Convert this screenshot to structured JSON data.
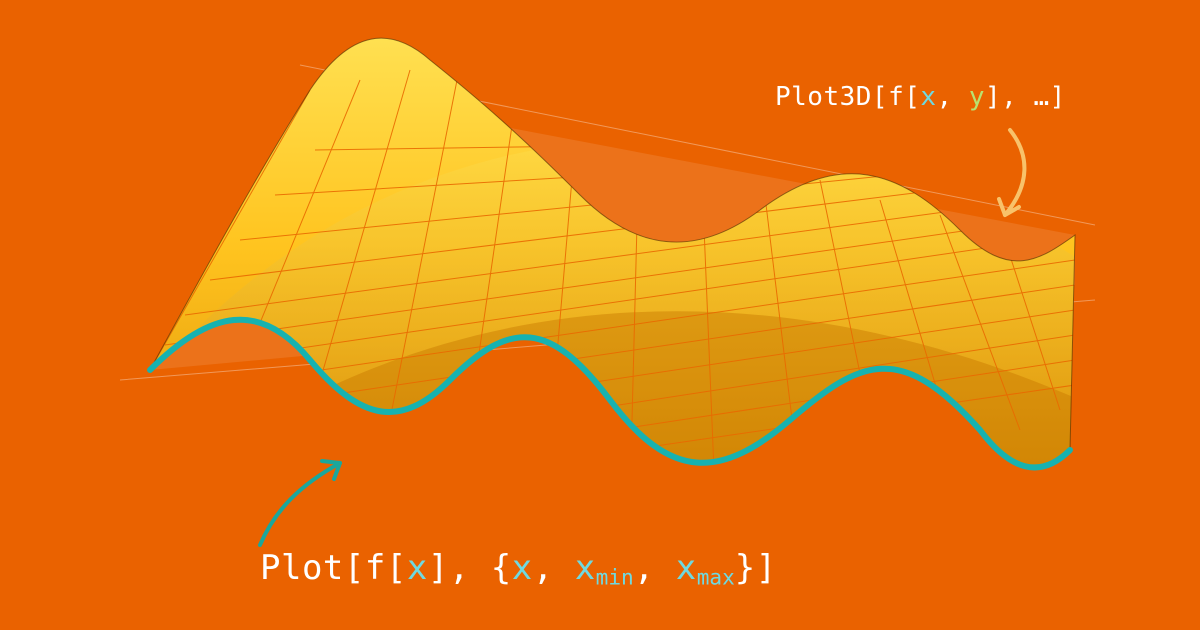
{
  "background_color": "#ea6200",
  "labels": {
    "top": {
      "fn": "Plot3D",
      "open": "[",
      "inner_fn": "f",
      "inner_open": "[",
      "arg1": "x",
      "sep1": ", ",
      "arg2": "y",
      "inner_close": "]",
      "sep2": ", ",
      "ellipsis": "…",
      "close": "]"
    },
    "bottom": {
      "fn": "Plot",
      "open": "[",
      "inner_fn": "f",
      "inner_open": "[",
      "arg1": "x",
      "inner_close": "]",
      "sep1": ", ",
      "brace_open": "{",
      "r_arg": "x",
      "sep2": ", ",
      "r_min_base": "x",
      "r_min_sub": "min",
      "sep3": ", ",
      "r_max_base": "x",
      "r_max_sub": "max",
      "brace_close": "}",
      "close": "]"
    }
  },
  "arrows": {
    "top_color": "#f8c26a",
    "bottom_color": "#1aa79c"
  },
  "surface": {
    "fill_bright": "#ffd338",
    "fill_dark": "#e99b00",
    "mesh_color": "#e96a00",
    "front_curve_color": "#17b2b0",
    "plane_fill": "rgba(255,255,255,0.22)",
    "plane_stroke": "rgba(255,255,255,0.55)"
  }
}
